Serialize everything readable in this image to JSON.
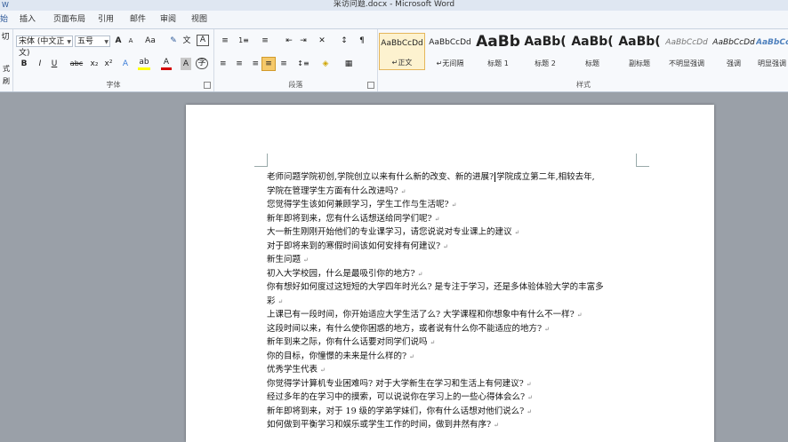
{
  "window": {
    "title": "采访问题.docx - Microsoft Word"
  },
  "tabs": [
    "插入",
    "页面布局",
    "引用",
    "邮件",
    "审阅",
    "视图"
  ],
  "partial_tab": "始",
  "clipboard": {
    "cut_partial": "切",
    "format_partial": "式刷"
  },
  "font": {
    "name": "宋体 (中文正文)",
    "size": "五号",
    "grow": "A",
    "shrink": "A",
    "case": "Aa",
    "clear": "✎",
    "phonetic": "文",
    "border": "A",
    "bold": "B",
    "italic": "I",
    "underline": "U",
    "strike": "abc",
    "sub": "x₂",
    "sup": "x²",
    "effects": "A",
    "highlight": "ab",
    "color": "A",
    "shade": "A",
    "enclose": "字",
    "group_label": "字体",
    "colors": {
      "highlight": "#ffff00",
      "font_color": "#d40000"
    }
  },
  "paragraph": {
    "group_label": "段落",
    "bullets": "≡",
    "numbering": "1≡",
    "multilevel": "≡",
    "dec_indent": "⇤",
    "inc_indent": "⇥",
    "chinese_layout": "✕",
    "sort": "↕",
    "show_marks": "¶",
    "align_left": "≡",
    "center": "≡",
    "align_right": "≡",
    "justify": "≡",
    "distribute": "≡",
    "line_spacing": "↕≡",
    "shading": "◈",
    "borders": "▦"
  },
  "styles": {
    "group_label": "样式",
    "items": [
      {
        "sample": "AaBbCcDd",
        "name": "↵正文"
      },
      {
        "sample": "AaBbCcDd",
        "name": "↵无间隔"
      },
      {
        "sample": "AaBb",
        "name": "标题 1"
      },
      {
        "sample": "AaBb(",
        "name": "标题 2"
      },
      {
        "sample": "AaBb(",
        "name": "标题"
      },
      {
        "sample": "AaBb(",
        "name": "副标题"
      },
      {
        "sample": "AaBbCcDd",
        "name": "不明显强调"
      },
      {
        "sample": "AaBbCcDd",
        "name": "强调"
      },
      {
        "sample": "AaBbCcD",
        "name": "明显强调"
      }
    ]
  },
  "document": {
    "lines": [
      {
        "text": "老师问题学院初创,学院创立以来有什么新的改变、新的进展?",
        "caret_after": true,
        "rest": "学院成立第二年,相较去年,"
      },
      {
        "text": "学院在管理学生方面有什么改进吗?",
        "mark": "↵"
      },
      {
        "text": "您觉得学生该如何兼顾学习，学生工作与生活呢?",
        "mark": "↵"
      },
      {
        "text": "新年即将到来，您有什么话想送给同学们呢?",
        "mark": "↵"
      },
      {
        "text": "大一新生刚刚开始他们的专业课学习，请您说说对专业课上的建议",
        "mark": "↵"
      },
      {
        "text": "对于即将来到的寒假时间该如何安排有何建议?",
        "mark": "↵"
      },
      {
        "text": "新生问题",
        "mark": "↵"
      },
      {
        "text": "初入大学校园，什么是最吸引你的地方?",
        "mark": "↵"
      },
      {
        "text": "你有想好如何度过这短短的大学四年时光么? 是专注于学习，还是多体验体验大学的丰富多",
        "mark": ""
      },
      {
        "text": "彩",
        "mark": "↵"
      },
      {
        "text": "上课已有一段时间，你开始适应大学生活了么? 大学课程和你想象中有什么不一样?",
        "mark": "↵"
      },
      {
        "text": "这段时间以来，有什么使你困惑的地方，或者说有什么你不能适应的地方?",
        "mark": "↵"
      },
      {
        "text": "新年到来之际，你有什么话要对同学们说吗",
        "mark": "↵"
      },
      {
        "text": "你的目标，你憧憬的未来是什么样的?",
        "mark": "↵"
      },
      {
        "text": "优秀学生代表",
        "mark": "↵"
      },
      {
        "text": "你觉得学计算机专业困难吗? 对于大学新生在学习和生活上有何建议?",
        "mark": "↵"
      },
      {
        "text": "经过多年的在学习中的摸索，可以说说你在学习上的一些心得体会么?",
        "mark": "↵"
      },
      {
        "text": "新年即将到来，对于 19 级的学弟学妹们，你有什么话想对他们说么?",
        "mark": "↵"
      },
      {
        "text": "如何做到平衡学习和娱乐或学生工作的时间，做到井然有序?",
        "mark": "↵"
      }
    ]
  }
}
